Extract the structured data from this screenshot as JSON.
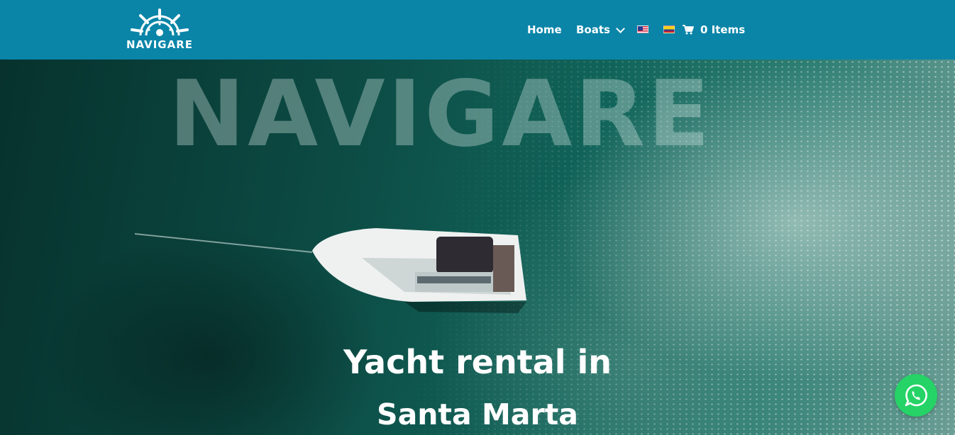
{
  "header": {
    "logo_text": "NAVIGARE",
    "nav": {
      "home": "Home",
      "boats": "Boats"
    },
    "flags": [
      "us-flag-icon",
      "colombia-flag-icon"
    ],
    "cart": {
      "icon": "cart-icon",
      "label": "0 Items"
    },
    "background_color": "#0a85a8"
  },
  "hero": {
    "background_word": "NAVIGARE",
    "headline_line1": "Yacht rental in",
    "headline_line2": "Santa Marta"
  },
  "whatsapp": {
    "icon": "whatsapp-icon",
    "color": "#25d366"
  }
}
